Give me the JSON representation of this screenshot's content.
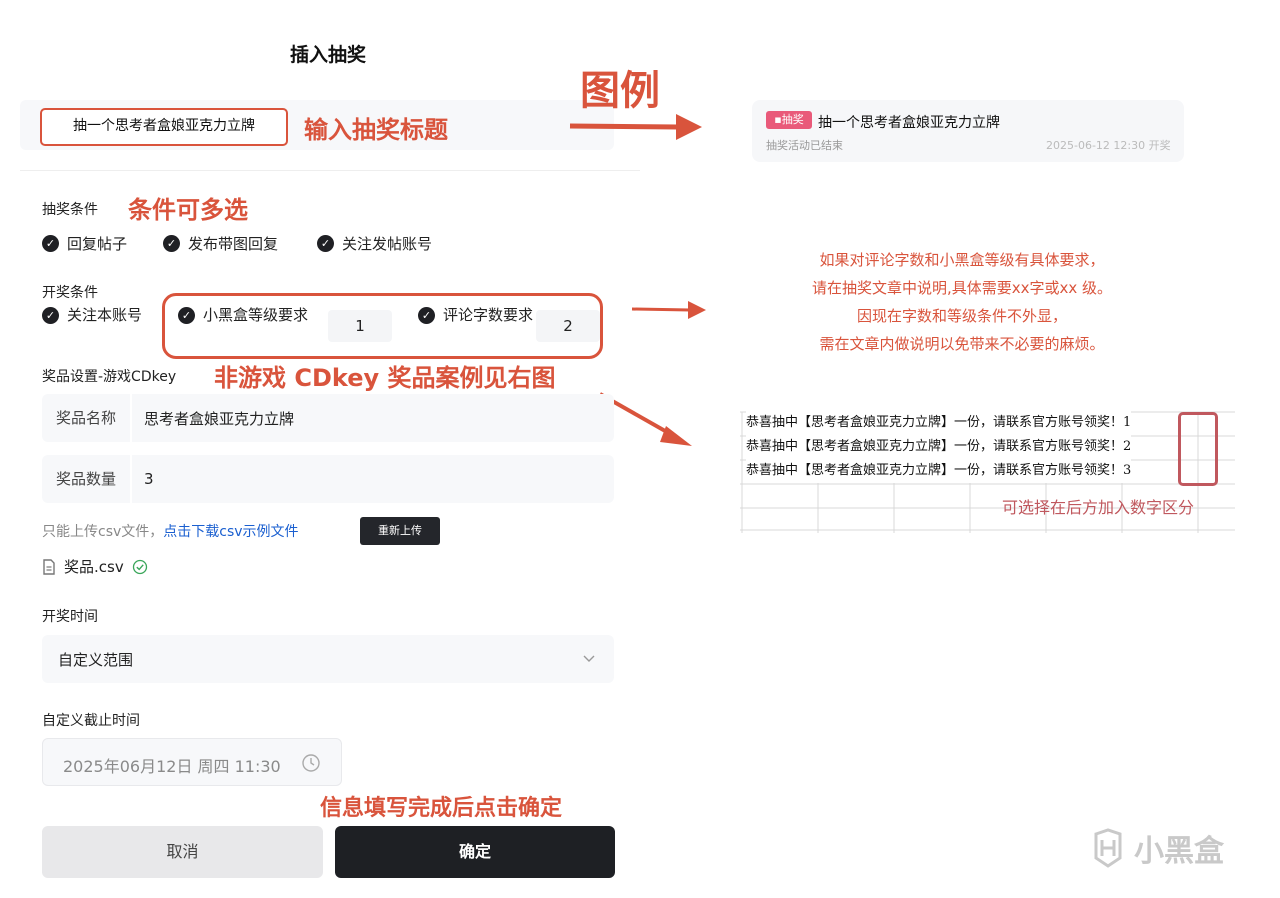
{
  "dialog": {
    "title": "插入抽奖",
    "lottery_title_value": "抽一个思考者盒娘亚克力立牌",
    "conditions_label": "抽奖条件",
    "conditions": [
      "回复帖子",
      "发布带图回复",
      "关注发帖账号"
    ],
    "draw_conditions_label": "开奖条件",
    "draw_condition_follow": "关注本账号",
    "draw_condition_level": "小黑盒等级要求",
    "draw_condition_level_value": "1",
    "draw_condition_words": "评论字数要求",
    "draw_condition_words_value": "2",
    "prize_settings_label": "奖品设置-游戏CDkey",
    "prize_name_label": "奖品名称",
    "prize_name_value": "思考者盒娘亚克力立牌",
    "prize_count_label": "奖品数量",
    "prize_count_value": "3",
    "upload_hint": "只能上传csv文件，",
    "upload_link": "点击下载csv示例文件",
    "reupload_button": "重新上传",
    "file_name": "奖品.csv",
    "draw_time_label": "开奖时间",
    "draw_time_value": "自定义范围",
    "deadline_label": "自定义截止时间",
    "deadline_value": "2025年06月12日 周四 11:30",
    "cancel_button": "取消",
    "confirm_button": "确定"
  },
  "annotations": {
    "legend": "图例",
    "enter_title": "输入抽奖标题",
    "multi_select": "条件可多选",
    "non_game_note": "非游戏 CDkey 奖品案例见右图",
    "finish_note": "信息填写完成后点击确定",
    "requirement_note": [
      "如果对评论字数和小黑盒等级有具体要求，",
      "请在抽奖文章中说明,具体需要xx字或xx 级。",
      "因现在字数和等级条件不外显，",
      "需在文章内做说明以免带来不必要的麻烦。"
    ],
    "sheet_note": "可选择在后方加入数字区分"
  },
  "preview": {
    "tag": "抽奖",
    "title": "抽一个思考者盒娘亚克力立牌",
    "status": "抽奖活动已结束",
    "time": "2025-06-12 12:30 开奖"
  },
  "sheet_rows": [
    "恭喜抽中【思考者盒娘亚克力立牌】一份，请联系官方账号领奖！1",
    "恭喜抽中【思考者盒娘亚克力立牌】一份，请联系官方账号领奖！2",
    "恭喜抽中【思考者盒娘亚克力立牌】一份，请联系官方账号领奖！3"
  ],
  "watermark": "小黑盒",
  "colors": {
    "annotation_red": "#d9543c",
    "dark_button": "#1e2024",
    "link_blue": "#1a5fd0",
    "success_green": "#3aa65a"
  },
  "icons": [
    "check-circle-icon",
    "chevron-down-icon",
    "clock-icon",
    "file-icon",
    "success-check-icon",
    "arrow-right-icon",
    "gamepad-icon"
  ]
}
